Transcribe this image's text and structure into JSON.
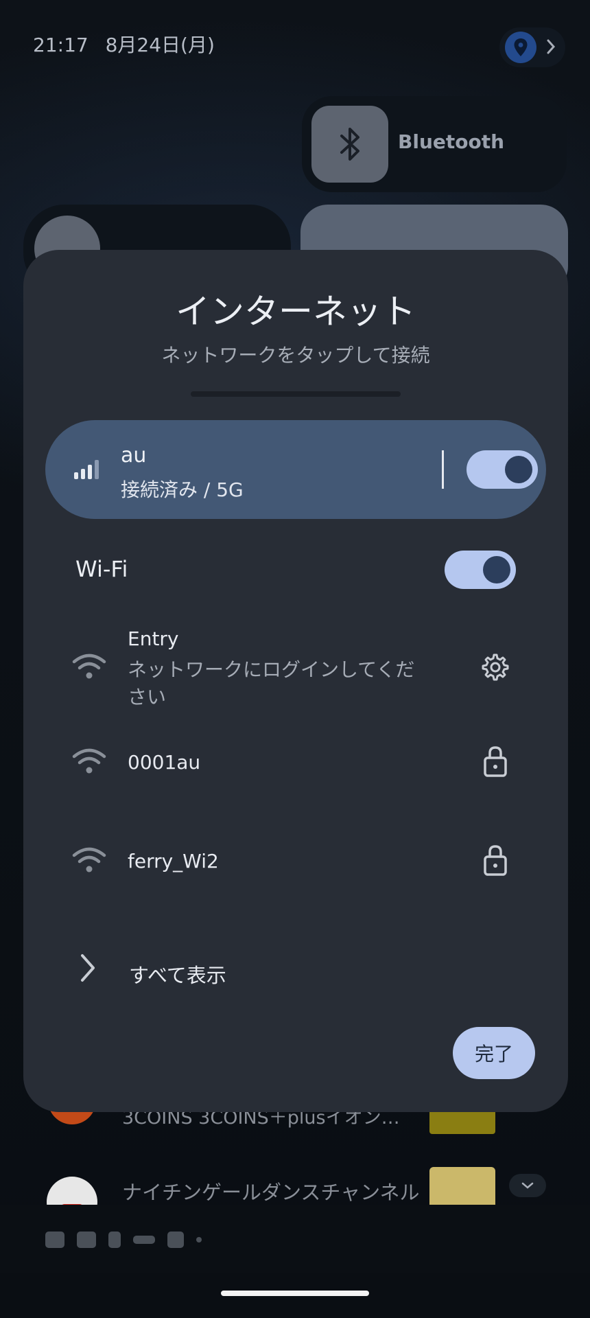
{
  "status_bar": {
    "time": "21:17",
    "date": "8月24日(月)"
  },
  "quick_tiles": {
    "bluetooth_label": "Bluetooth"
  },
  "background_notifications": [
    {
      "text": "3COINS 3COINS＋plusイオン…"
    },
    {
      "text": "ナイチンゲールダンスチャンネル"
    }
  ],
  "dialog": {
    "title": "インターネット",
    "subtitle": "ネットワークをタップして接続",
    "mobile_network": {
      "name": "au",
      "status": "接続済み / 5G",
      "enabled": true
    },
    "wifi": {
      "label": "Wi-Fi",
      "enabled": true
    },
    "access_points": [
      {
        "name": "Entry",
        "description": "ネットワークにログインしてください",
        "trailing_icon": "gear-icon"
      },
      {
        "name": "0001au",
        "trailing_icon": "lock-icon"
      },
      {
        "name": "ferry_Wi2",
        "trailing_icon": "lock-icon"
      }
    ],
    "show_all_label": "すべて表示",
    "done_label": "完了"
  },
  "colors": {
    "dialog_bg": "#282d36",
    "connected_card": "#435875",
    "toggle_track": "#b5c7ef",
    "toggle_knob": "#2c3e5c",
    "done_button": "#b7c8ef"
  }
}
